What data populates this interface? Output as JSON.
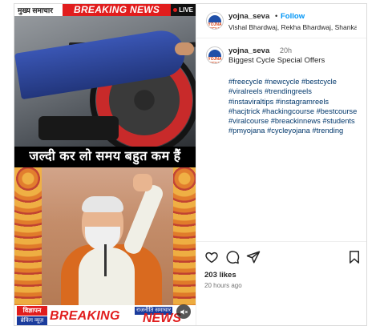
{
  "media": {
    "top_category": "मुख्य समाचार",
    "top_banner": "BREAKING NEWS",
    "live_label": "LIVE",
    "caption_hindi": "जल्दी कर लो समय बहुत कम हैं",
    "ad_tag": "विज्ञापन",
    "ad_sub": "ब्रेकिंग न्यूज़",
    "bottom_banner_left": "BREAKING",
    "bottom_news_tag": "राजनीति समाचार",
    "bottom_banner_right": "NEWS"
  },
  "header": {
    "username": "yojna_seva",
    "separator": "•",
    "follow_label": "Follow",
    "collaborators": "Vishal Bhardwaj, Rekha Bhardwaj, Shanka..."
  },
  "avatar": {
    "text": "YOJNA SEVA"
  },
  "caption": {
    "username": "yojna_seva",
    "time": "20h",
    "text": "Biggest Cycle Special Offers",
    "hashtags": [
      "#freecycle",
      "#newcycle",
      "#bestcycle",
      "#viralreels",
      "#trendingreels",
      "#instaviraltips",
      "#instagramreels",
      "#hacjtrick",
      "#hackingcourse",
      "#bestcourse",
      "#viralcourse",
      "#breackinnews",
      "#students",
      "#pmyojana",
      "#cycleyojana",
      "#trending"
    ]
  },
  "actions": {
    "likes": "203 likes",
    "posted_ago": "20 hours ago",
    "icons": [
      "heart-icon",
      "comment-icon",
      "share-icon",
      "bookmark-icon"
    ]
  },
  "colors": {
    "accent": "#0095f6",
    "hashtag": "#00376b",
    "breaking_red": "#e11d1d"
  }
}
